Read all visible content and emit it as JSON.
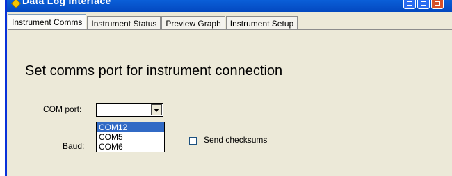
{
  "window": {
    "title": "Data Log Interface",
    "colors": {
      "titlebar": "#0348c0",
      "close": "#d6502a",
      "selection": "#316ac5"
    }
  },
  "tabs": [
    {
      "label": "Instrument Comms",
      "active": true
    },
    {
      "label": "Instrument Status",
      "active": false
    },
    {
      "label": "Preview Graph",
      "active": false
    },
    {
      "label": "Instrument Setup",
      "active": false
    }
  ],
  "main": {
    "heading": "Set comms port for instrument connection",
    "com_port": {
      "label": "COM port:",
      "value": "",
      "options": [
        "COM12",
        "COM5",
        "COM6"
      ],
      "selected": "COM12"
    },
    "baud": {
      "label": "Baud:"
    },
    "send_checksums": {
      "label": "Send checksums",
      "checked": false
    }
  }
}
